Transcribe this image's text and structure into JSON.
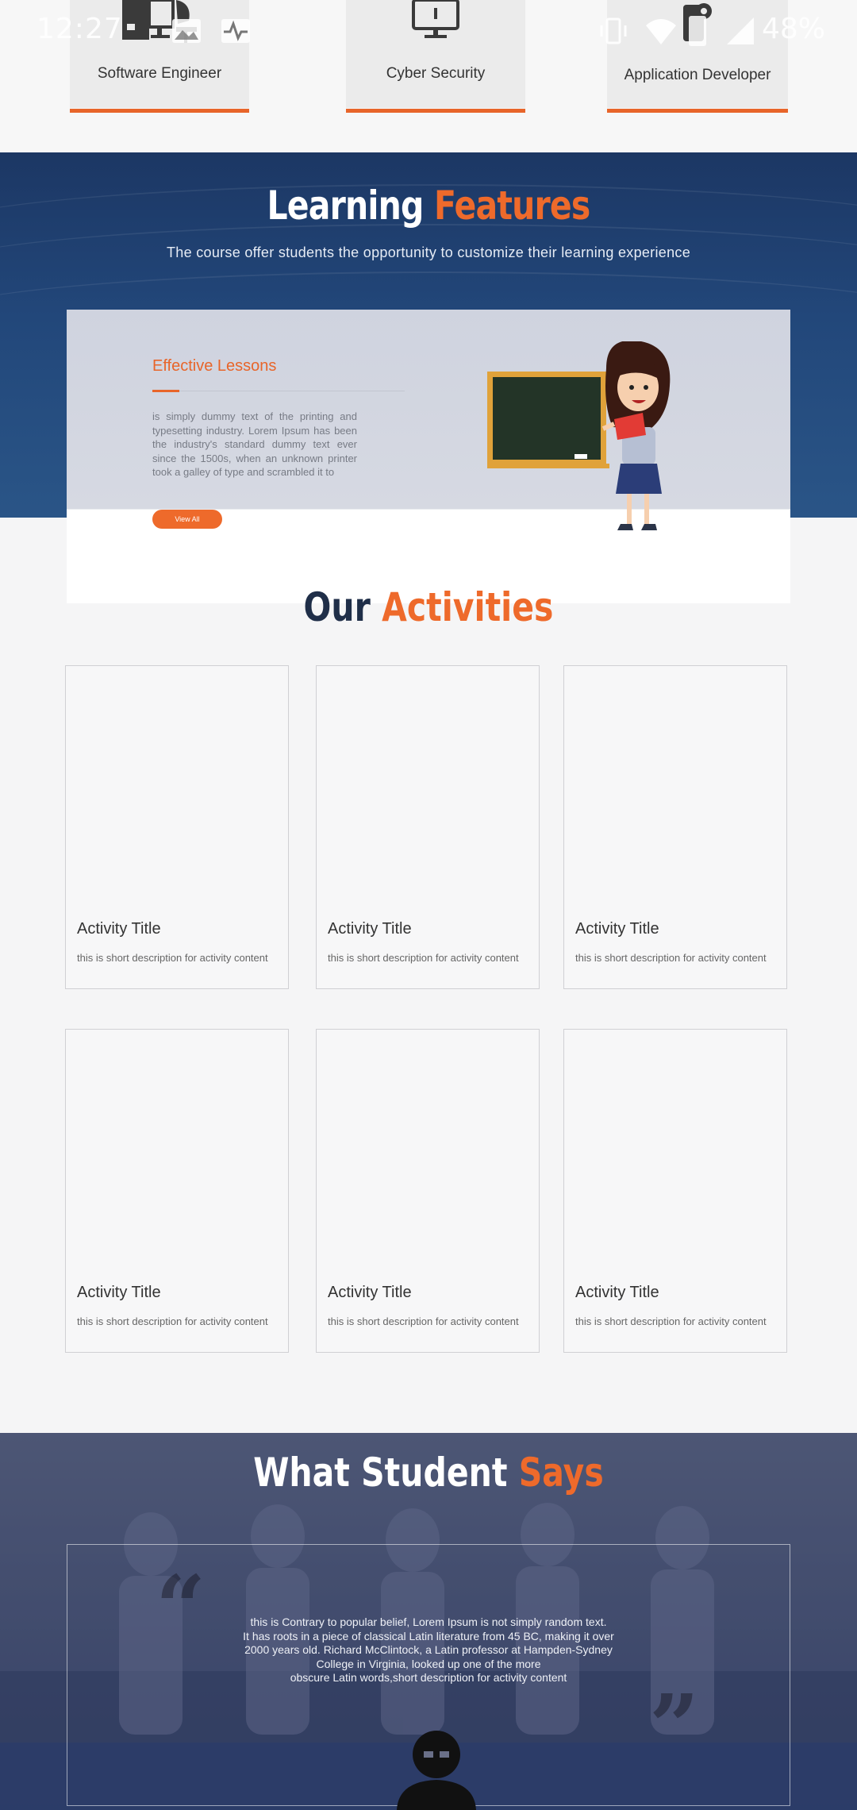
{
  "status_bar": {
    "time": "12:27",
    "battery": "48%"
  },
  "categories": [
    {
      "label": "Software Engineer",
      "icon": "desk-computer-icon"
    },
    {
      "label": "Cyber Security",
      "icon": "monitor-icon"
    },
    {
      "label": "Application Developer",
      "icon": "mobile-gear-icon"
    }
  ],
  "learning_features": {
    "title_part1": "Learning",
    "title_part2": "Features",
    "subtitle": "The course offer students the opportunity to customize their learning experience",
    "card": {
      "title": "Effective Lessons",
      "text": "is simply dummy text of the printing and typesetting industry. Lorem Ipsum has been the industry's standard dummy text ever since the 1500s, when an unknown printer took a galley of type and scrambled it to",
      "button": "View All"
    }
  },
  "activities": {
    "title_part1": "Our",
    "title_part2": "Activities",
    "items": [
      {
        "title": "Activity Title",
        "description": "this is short description for activity content"
      },
      {
        "title": "Activity Title",
        "description": "this is short description for activity content"
      },
      {
        "title": "Activity Title",
        "description": "this is short description for activity content"
      },
      {
        "title": "Activity Title",
        "description": "this is short description for activity content"
      },
      {
        "title": "Activity Title",
        "description": "this is short description for activity content"
      },
      {
        "title": "Activity Title",
        "description": "this is short description for activity content"
      }
    ]
  },
  "testimonials": {
    "title_part1": "What Student",
    "title_part2": "Says",
    "quote_lines": [
      "this is Contrary to popular belief, Lorem Ipsum is not simply random text.",
      "It has roots in a piece of classical Latin literature from 45 BC, making it over",
      "2000 years old. Richard McClintock, a Latin professor at Hampden-Sydney",
      "College in Virginia, looked up one of the more",
      "obscure Latin words,short description for activity content"
    ]
  },
  "colors": {
    "accent": "#ee6a2b",
    "navy": "#1c3764",
    "dark_text": "#1f2e48"
  }
}
